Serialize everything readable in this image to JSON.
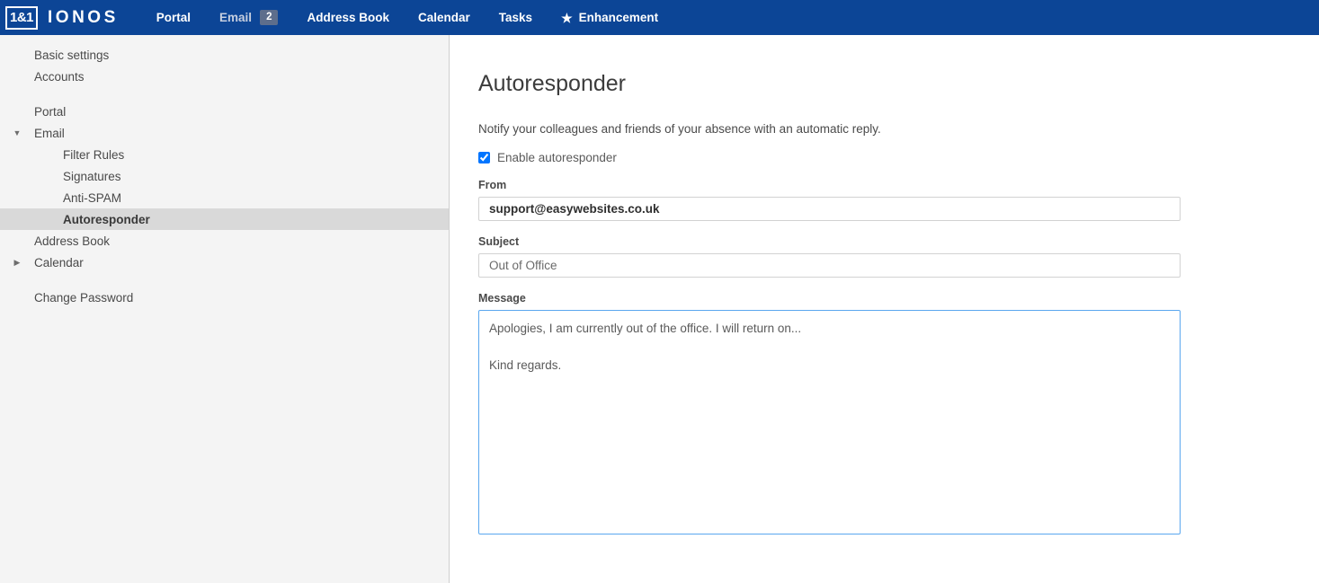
{
  "topnav": {
    "brand": {
      "box": "1&1",
      "word": "IONOS"
    },
    "items": [
      {
        "label": "Portal",
        "badge": null,
        "icon": null,
        "muted": false
      },
      {
        "label": "Email",
        "badge": "2",
        "icon": null,
        "muted": true
      },
      {
        "label": "Address Book",
        "badge": null,
        "icon": null,
        "muted": false
      },
      {
        "label": "Calendar",
        "badge": null,
        "icon": null,
        "muted": false
      },
      {
        "label": "Tasks",
        "badge": null,
        "icon": null,
        "muted": false
      },
      {
        "label": "Enhancement",
        "badge": null,
        "icon": "star-icon",
        "muted": false
      }
    ],
    "background_color": "#0c4596",
    "badge_color": "#5d6e8c"
  },
  "sidebar": {
    "items": [
      {
        "label": "Basic settings",
        "indent": 1,
        "arrow": null,
        "selected": false
      },
      {
        "label": "Accounts",
        "indent": 1,
        "arrow": null,
        "selected": false
      },
      {
        "label": "Portal",
        "indent": 1,
        "arrow": null,
        "selected": false
      },
      {
        "label": "Email",
        "indent": 1,
        "arrow": "chevron-down-icon",
        "selected": false
      },
      {
        "label": "Filter Rules",
        "indent": 2,
        "arrow": null,
        "selected": false
      },
      {
        "label": "Signatures",
        "indent": 2,
        "arrow": null,
        "selected": false
      },
      {
        "label": "Anti-SPAM",
        "indent": 2,
        "arrow": null,
        "selected": false
      },
      {
        "label": "Autoresponder",
        "indent": 2,
        "arrow": null,
        "selected": true
      },
      {
        "label": "Address Book",
        "indent": 1,
        "arrow": null,
        "selected": false
      },
      {
        "label": "Calendar",
        "indent": 1,
        "arrow": "chevron-right-icon",
        "selected": false
      },
      {
        "label": "Change Password",
        "indent": 1,
        "arrow": null,
        "selected": false
      }
    ],
    "selected_background": "#d9d9d9",
    "background_color": "#f4f4f4"
  },
  "main": {
    "title": "Autoresponder",
    "subtitle": "Notify your colleagues and friends of your absence with an automatic reply.",
    "enable_label": "Enable autoresponder",
    "enable_checked": true,
    "fields": {
      "from": {
        "label": "From",
        "value": "support@easywebsites.co.uk",
        "placeholder": "From"
      },
      "subject": {
        "label": "Subject",
        "value": "Out of Office",
        "placeholder": "Subject"
      },
      "message": {
        "label": "Message",
        "value": "Apologies, I am currently out of the office. I will return on...\n\nKind regards.",
        "placeholder": "Message",
        "focused": true,
        "focus_border_color": "#5aa7ef"
      }
    }
  }
}
